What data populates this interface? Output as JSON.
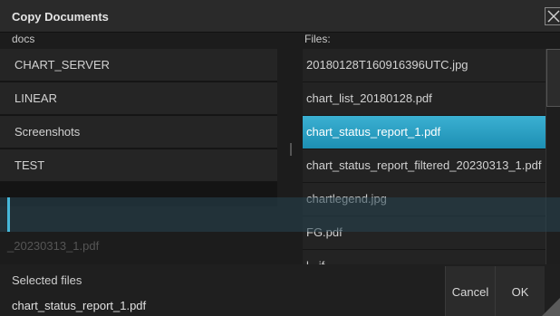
{
  "dialog": {
    "title": "Copy Documents",
    "close_icon": "close-icon"
  },
  "left_panel": {
    "header": "docs",
    "items": [
      {
        "label": "CHART_SERVER"
      },
      {
        "label": "LINEAR"
      },
      {
        "label": "Screenshots"
      },
      {
        "label": "TEST"
      }
    ],
    "drag_ghost_text": "_20230313_1.pdf"
  },
  "right_panel": {
    "header": "Files:",
    "items": [
      {
        "label": "20180128T160916396UTC.jpg",
        "selected": false
      },
      {
        "label": "chart_list_20180128.pdf",
        "selected": false
      },
      {
        "label": "chart_status_report_1.pdf",
        "selected": true
      },
      {
        "label": "chart_status_report_filtered_20230313_1.pdf",
        "selected": false
      },
      {
        "label": "chartlegend.jpg",
        "selected": false
      },
      {
        "label": "FG.pdf",
        "selected": false
      },
      {
        "label": "l...if",
        "selected": false
      }
    ]
  },
  "footer": {
    "selected_label": "Selected files",
    "selected_value": "chart_status_report_1.pdf",
    "cancel_label": "Cancel",
    "ok_label": "OK"
  },
  "colors": {
    "accent": "#2fa3c8",
    "background": "#1c1c1c",
    "row": "#252525"
  }
}
